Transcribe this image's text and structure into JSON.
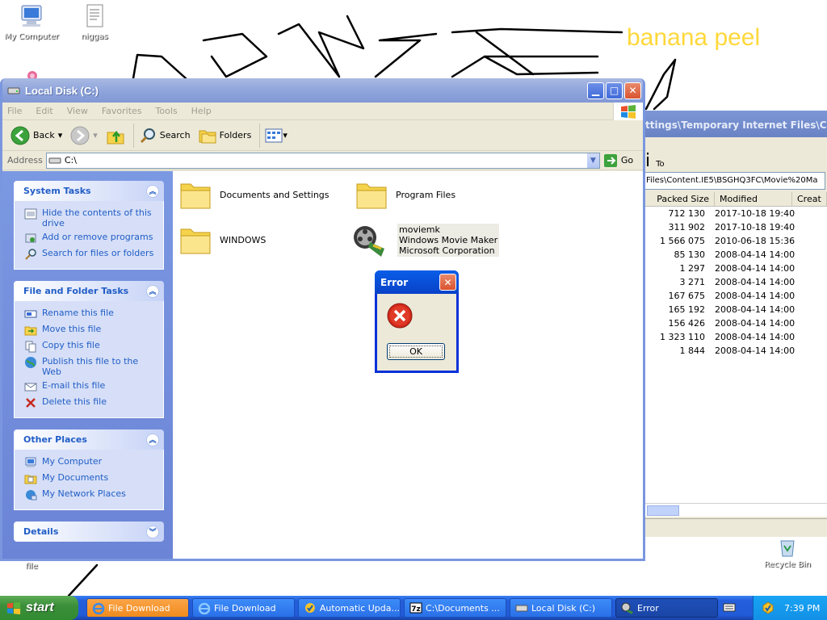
{
  "desktop": {
    "icons": [
      {
        "label": "My Computer",
        "icon": "my-computer-icon"
      },
      {
        "label": "niggas",
        "icon": "text-document-icon"
      },
      {
        "label": "file",
        "icon": "file-icon"
      },
      {
        "label": "Recycle Bin",
        "icon": "recycle-bin-icon"
      }
    ],
    "overlay_text": "banana peel",
    "overlay_color": "#ffd83a"
  },
  "background_window": {
    "title": "ttings\\Temporary Internet Files\\Cont",
    "toolbar_fragment": "i",
    "toolbar_fragment_2": "To",
    "path": "Files\\Content.IE5\\BSGHQ3FC\\Movie%20Ma",
    "columns": [
      "Packed Size",
      "Modified",
      "Creat"
    ],
    "rows": [
      {
        "packed": "712 130",
        "modified": "2017-10-18 19:40"
      },
      {
        "packed": "311 902",
        "modified": "2017-10-18 19:40"
      },
      {
        "packed": "1 566 075",
        "modified": "2010-06-18 15:36"
      },
      {
        "packed": "85 130",
        "modified": "2008-04-14 14:00"
      },
      {
        "packed": "1 297",
        "modified": "2008-04-14 14:00"
      },
      {
        "packed": "3 271",
        "modified": "2008-04-14 14:00"
      },
      {
        "packed": "167 675",
        "modified": "2008-04-14 14:00"
      },
      {
        "packed": "165 192",
        "modified": "2008-04-14 14:00"
      },
      {
        "packed": "156 426",
        "modified": "2008-04-14 14:00"
      },
      {
        "packed": "1 323 110",
        "modified": "2008-04-14 14:00"
      },
      {
        "packed": "1 844",
        "modified": "2008-04-14 14:00"
      }
    ]
  },
  "explorer": {
    "title": "Local Disk (C:)",
    "menu": [
      "File",
      "Edit",
      "View",
      "Favorites",
      "Tools",
      "Help"
    ],
    "toolbar": {
      "back": "Back",
      "search": "Search",
      "folders": "Folders"
    },
    "address": {
      "label": "Address",
      "value": "C:\\",
      "go": "Go"
    },
    "panels": {
      "system_tasks": {
        "title": "System Tasks",
        "items": [
          "Hide the contents of this drive",
          "Add or remove programs",
          "Search for files or folders"
        ]
      },
      "file_tasks": {
        "title": "File and Folder Tasks",
        "items": [
          "Rename this file",
          "Move this file",
          "Copy this file",
          "Publish this file to the Web",
          "E-mail this file",
          "Delete this file"
        ]
      },
      "other_places": {
        "title": "Other Places",
        "items": [
          "My Computer",
          "My Documents",
          "My Network Places"
        ]
      },
      "details": {
        "title": "Details"
      }
    },
    "items": [
      {
        "name": "Documents and Settings",
        "type": "folder"
      },
      {
        "name": "Program Files",
        "type": "folder"
      },
      {
        "name": "WINDOWS",
        "type": "folder"
      },
      {
        "name": "moviemk",
        "line2": "Windows Movie Maker",
        "line3": "Microsoft Corporation",
        "type": "app"
      }
    ]
  },
  "error_dialog": {
    "title": "Error",
    "ok": "OK"
  },
  "taskbar": {
    "start": "start",
    "tasks": [
      "File Download",
      "File Download",
      "Automatic Upda...",
      "C:\\Documents ...",
      "Local Disk (C:)",
      "Error"
    ],
    "clock": "7:39 PM"
  },
  "colors": {
    "accent": "#0a5de8",
    "task_flash": "#f08b1e",
    "link": "#215dc6"
  }
}
